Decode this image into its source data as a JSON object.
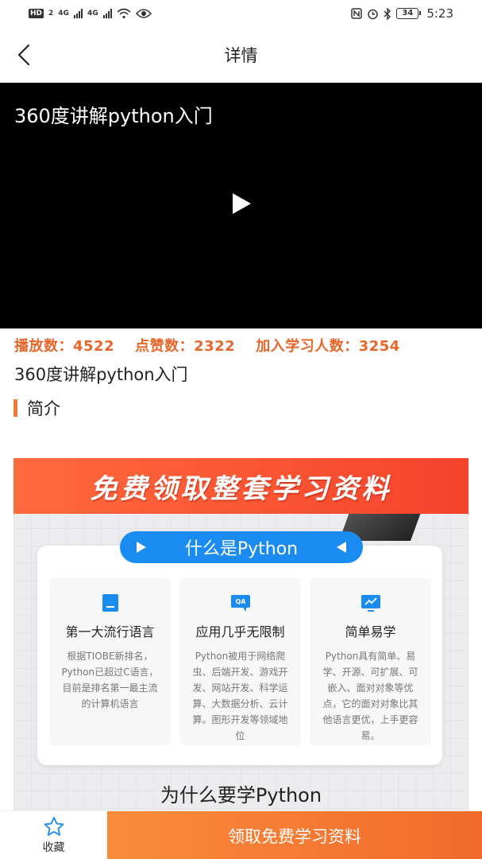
{
  "status_bar": {
    "hd": "HD",
    "sim": "2",
    "net1": "4G",
    "net2": "4G",
    "battery": "34",
    "time": "5:23"
  },
  "nav": {
    "title": "详情",
    "back_icon": "chevron-left-icon"
  },
  "video": {
    "title": "360度讲解python入门",
    "play_icon": "play-icon",
    "background": "#000000"
  },
  "stats": {
    "plays": "播放数：4522",
    "likes": "点赞数：2322",
    "learners": "加入学习人数：3254",
    "color": "#e8662a"
  },
  "course": {
    "name": "360度讲解python入门"
  },
  "intro": {
    "title": "简介",
    "accent": "#f07a37"
  },
  "banner": {
    "headline": "免费领取整套学习资料",
    "pill": "什么是Python",
    "features": [
      {
        "icon": "document-icon",
        "title": "第一大流行语言",
        "desc": "根据TIOBE新排名，Python已超过C语言，目前是排名第一最主流的计算机语言"
      },
      {
        "icon": "qa-chat-icon",
        "title": "应用几乎无限制",
        "desc": "Python被用于网络爬虫、后端开发、游戏开发、网站开发、科学运算、大数据分析、云计算。图形开发等领域地位"
      },
      {
        "icon": "chart-monitor-icon",
        "title": "简单易学",
        "desc": "Python具有简单、易学、开源、可扩展、可嵌入、面对对象等优点，它的面对对象比其他语言更优，上手更容易。"
      }
    ],
    "footer": "为什么要学Python"
  },
  "bottom": {
    "fav_label": "收藏",
    "fav_icon": "star-outline-icon",
    "cta_label": "领取免费学习资料",
    "cta_color": "#f26a2a"
  }
}
